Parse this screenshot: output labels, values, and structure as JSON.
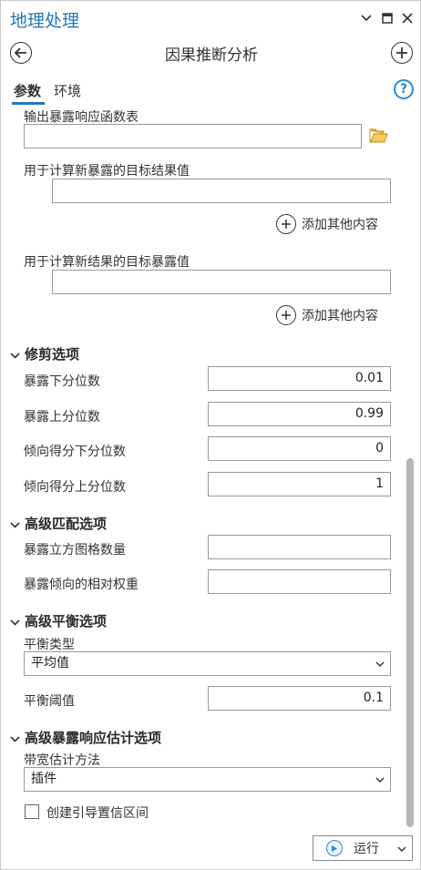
{
  "window": {
    "title": "地理处理"
  },
  "tool": {
    "title": "因果推断分析"
  },
  "tabs": [
    "参数",
    "环境"
  ],
  "params": {
    "output_erf_table_label": "输出暴露响应函数表",
    "output_erf_table_value": "",
    "target_outcome_label": "用于计算新暴露的目标结果值",
    "target_outcome_value": "",
    "add_other_1": "添加其他内容",
    "target_exposure_label": "用于计算新结果的目标暴露值",
    "target_exposure_value": "",
    "add_other_2": "添加其他内容"
  },
  "trim": {
    "section": "修剪选项",
    "exposure_lower_label": "暴露下分位数",
    "exposure_lower_value": "0.01",
    "exposure_upper_label": "暴露上分位数",
    "exposure_upper_value": "0.99",
    "ps_lower_label": "倾向得分下分位数",
    "ps_lower_value": "0",
    "ps_upper_label": "倾向得分上分位数",
    "ps_upper_value": "1"
  },
  "matching": {
    "section": "高级匹配选项",
    "cube_count_label": "暴露立方图格数量",
    "cube_count_value": "",
    "weight_label": "暴露倾向的相对权重",
    "weight_value": ""
  },
  "balancing": {
    "section": "高级平衡选项",
    "type_label": "平衡类型",
    "type_value": "平均值",
    "threshold_label": "平衡阈值",
    "threshold_value": "0.1"
  },
  "erf": {
    "section": "高级暴露响应估计选项",
    "bandwidth_label": "带宽估计方法",
    "bandwidth_value": "插件",
    "bootstrap_label": "创建引导置信区间",
    "bootstrap_checked": false
  },
  "run": {
    "label": "运行"
  },
  "colors": {
    "accent": "#2377b7",
    "help": "#2d8ad4",
    "folder": "#e8b33a"
  }
}
